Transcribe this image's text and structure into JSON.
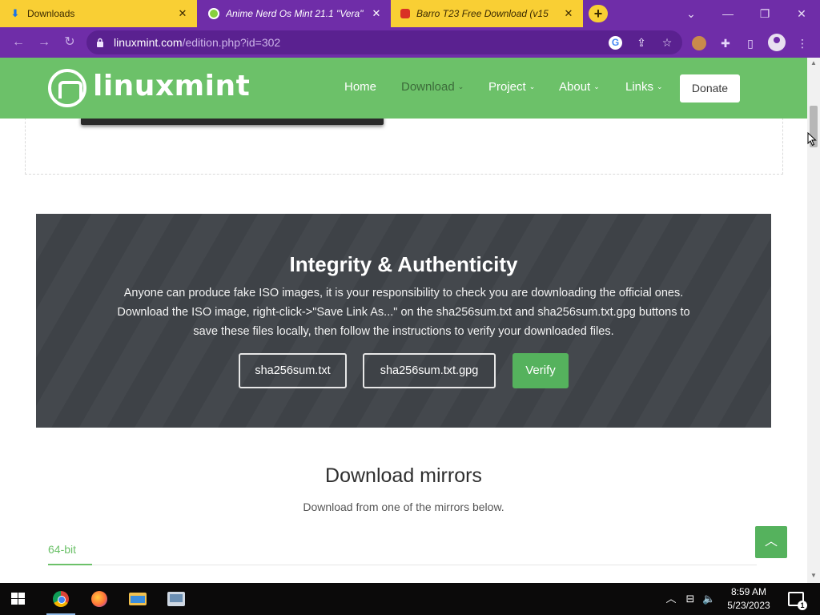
{
  "browser": {
    "tabs": [
      {
        "label": "Downloads",
        "icon": "download-icon"
      },
      {
        "label": "Anime Nerd Os Mint 21.1 \"Vera\"",
        "icon": "linuxmint-favicon"
      },
      {
        "label": "Barro T23 Free Download (v15",
        "icon": "lock-favicon"
      }
    ],
    "new_tab": "+",
    "window_controls": {
      "chevron": "⌄",
      "minimize": "—",
      "maximize": "❐",
      "close": "✕"
    },
    "url_host": "linuxmint.com",
    "url_path": "/edition.php?id=302",
    "tab_close": "✕"
  },
  "site": {
    "logo_text": "linuxmint",
    "nav": [
      {
        "label": "Home",
        "caret": ""
      },
      {
        "label": "Download",
        "caret": "⌄"
      },
      {
        "label": "Project",
        "caret": "⌄"
      },
      {
        "label": "About",
        "caret": "⌄"
      },
      {
        "label": "Links",
        "caret": "⌄"
      }
    ],
    "donate": "Donate"
  },
  "integrity": {
    "title": "Integrity & Authenticity",
    "lines": [
      "Anyone can produce fake ISO images, it is your responsibility to check you are downloading the official ones.",
      "Download the ISO image, right-click->\"Save Link As...\" on the sha256sum.txt and sha256sum.txt.gpg buttons to",
      "save these files locally, then follow the instructions to verify your downloaded files."
    ],
    "buttons": [
      "sha256sum.txt",
      "sha256sum.txt.gpg"
    ],
    "verify": "Verify"
  },
  "mirrors": {
    "title": "Download mirrors",
    "subtitle": "Download from one of the mirrors below.",
    "tab": "64-bit"
  },
  "taskbar": {
    "time": "8:59 AM",
    "date": "5/23/2023",
    "notification_count": "1"
  },
  "colors": {
    "browser_theme": "#6f2da8",
    "tab_yellow": "#f9cf34",
    "mint_green": "#6cc169",
    "verify_green": "#55b25d",
    "integrity_bg": "#3e4247"
  }
}
